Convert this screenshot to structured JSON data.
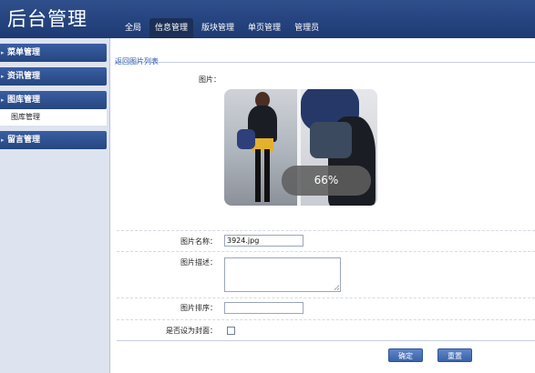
{
  "app": {
    "title": "后台管理"
  },
  "nav": {
    "tabs": [
      "全局",
      "信息管理",
      "版块管理",
      "单页管理",
      "管理员"
    ],
    "active_index": 1
  },
  "sidebar": {
    "items": [
      {
        "label": "菜单管理"
      },
      {
        "label": "资讯管理"
      },
      {
        "label": "图库管理",
        "sub": "图库管理"
      },
      {
        "label": "留言管理"
      }
    ]
  },
  "main": {
    "back_link": "返回图片列表",
    "image_label": "图片：",
    "upload_progress": "66%",
    "name_label": "图片名称：",
    "name_value": "3924.jpg",
    "desc_label": "图片描述：",
    "desc_value": "",
    "order_label": "图片排序：",
    "order_value": "",
    "cover_label": "是否设为封面：",
    "cover_checked": false,
    "confirm_label": "确定",
    "reset_label": "重置"
  },
  "colors": {
    "header": "#23407a",
    "accent": "#3a62a8"
  }
}
